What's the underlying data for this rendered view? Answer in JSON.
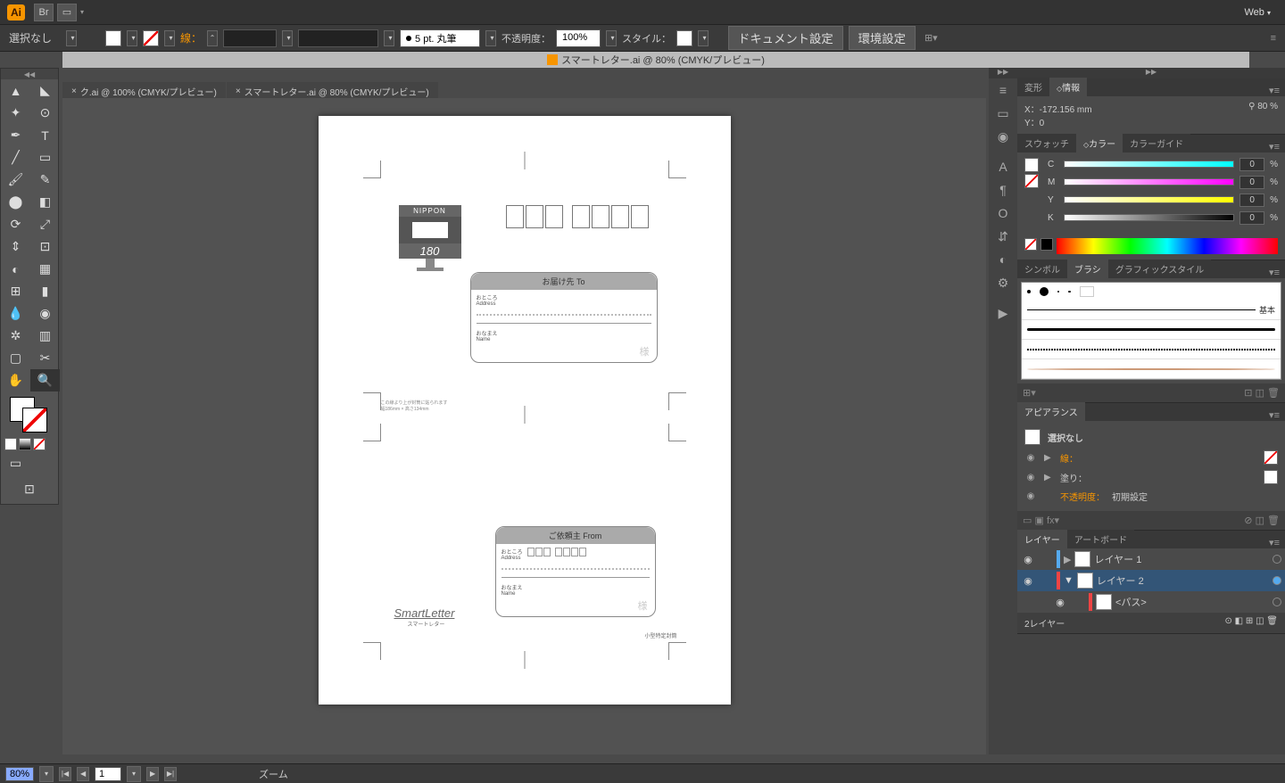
{
  "app": {
    "logo": "Ai",
    "web_dropdown": "Web"
  },
  "control": {
    "selection": "選択なし",
    "stroke_label": "線：",
    "brush_size": "5 pt. 丸筆",
    "opacity_label": "不透明度：",
    "opacity_value": "100%",
    "style_label": "スタイル：",
    "doc_setup": "ドキュメント設定",
    "preferences": "環境設定"
  },
  "doc_title": "スマートレター.ai @ 80% (CMYK/プレビュー)",
  "tabs": {
    "tab1": "ク.ai @ 100% (CMYK/プレビュー)",
    "tab2": "スマートレター.ai @ 80% (CMYK/プレビュー)",
    "close": "×"
  },
  "artboard": {
    "nippon": "NIPPON",
    "price": "180",
    "to_header": "お届け先  To",
    "from_header": "ご依頼主  From",
    "addr_label": "おところ\nAddress",
    "name_label": "おなまえ\nName",
    "addr_label2": "おところ\nAddress",
    "name_label2": "おなまえ\nName",
    "sama": "様",
    "smart_letter": "SmartLetter",
    "smart_sub": "スマートレター",
    "note": "この線より上が封筒に貼られます\n幅186mm × 高さ134mm",
    "reg": "小型特定封筒"
  },
  "panels": {
    "transform_tab": "変形",
    "info_tab": "情報",
    "x_label": "X：",
    "x_val": "-172.156 mm",
    "y_label": "Y：",
    "y_val": "0",
    "zoom_icon": "⚲",
    "zoom_val": "80 %",
    "swatch_tab": "スウォッチ",
    "color_tab": "カラー",
    "colorguide_tab": "カラーガイド",
    "c": "C",
    "m": "M",
    "y": "Y",
    "k": "K",
    "c_val": "0",
    "m_val": "0",
    "k_val": "0",
    "pct": "%",
    "symbol_tab": "シンボル",
    "brush_tab": "ブラシ",
    "gstyle_tab": "グラフィックスタイル",
    "brush_basic": "基本",
    "appearance_tab": "アピアランス",
    "appear_none": "選択なし",
    "appear_stroke": "線：",
    "appear_fill": "塗り：",
    "appear_opacity": "不透明度：",
    "appear_default": "初期設定",
    "layer_tab": "レイヤー",
    "artboard_tab": "アートボード",
    "layer1": "レイヤー 1",
    "layer2": "レイヤー 2",
    "path": "<パス>",
    "layer_count": "2レイヤー"
  },
  "status": {
    "zoom": "80%",
    "artboard_num": "1",
    "zoom_label": "ズーム"
  }
}
